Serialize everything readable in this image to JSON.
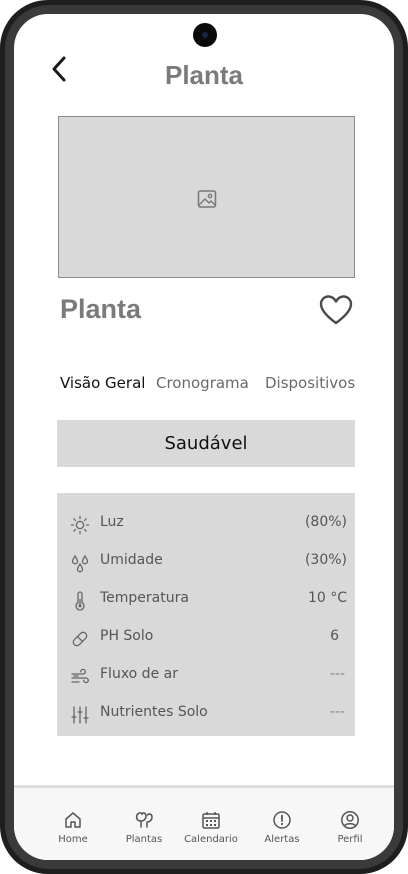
{
  "header": {
    "title": "Planta",
    "back_icon": "chevron-left-icon"
  },
  "plant": {
    "name": "Planta",
    "image_icon": "image-placeholder-icon",
    "favorite_icon": "heart-outline-icon"
  },
  "tabs": [
    {
      "label": "Visão Geral",
      "active": true
    },
    {
      "label": "Cronograma",
      "active": false
    },
    {
      "label": "Dispositivos",
      "active": false
    }
  ],
  "status": {
    "label": "Saudável"
  },
  "metrics": [
    {
      "label": "Luz",
      "value": "(80%)",
      "icon": "sun-icon"
    },
    {
      "label": "Umidade",
      "value": "(30%)",
      "icon": "humidity-icon"
    },
    {
      "label": "Temperatura",
      "value": "10 °C",
      "icon": "thermometer-icon"
    },
    {
      "label": "PH Solo",
      "value": "6",
      "icon": "pill-icon"
    },
    {
      "label": "Fluxo de ar",
      "value": "---",
      "icon": "wind-icon"
    },
    {
      "label": "Nutrientes Solo",
      "value": "---",
      "icon": "sliders-icon"
    }
  ],
  "nav": [
    {
      "label": "Home",
      "icon": "home-icon"
    },
    {
      "label": "Plantas",
      "icon": "plants-icon"
    },
    {
      "label": "Calendario",
      "icon": "calendar-icon"
    },
    {
      "label": "Alertas",
      "icon": "alert-icon"
    },
    {
      "label": "Perfil",
      "icon": "profile-icon"
    }
  ],
  "colors": {
    "panel_gray": "#d9d9d9",
    "title_gray": "#7a7a7a",
    "frame": "#1e1e1e"
  }
}
